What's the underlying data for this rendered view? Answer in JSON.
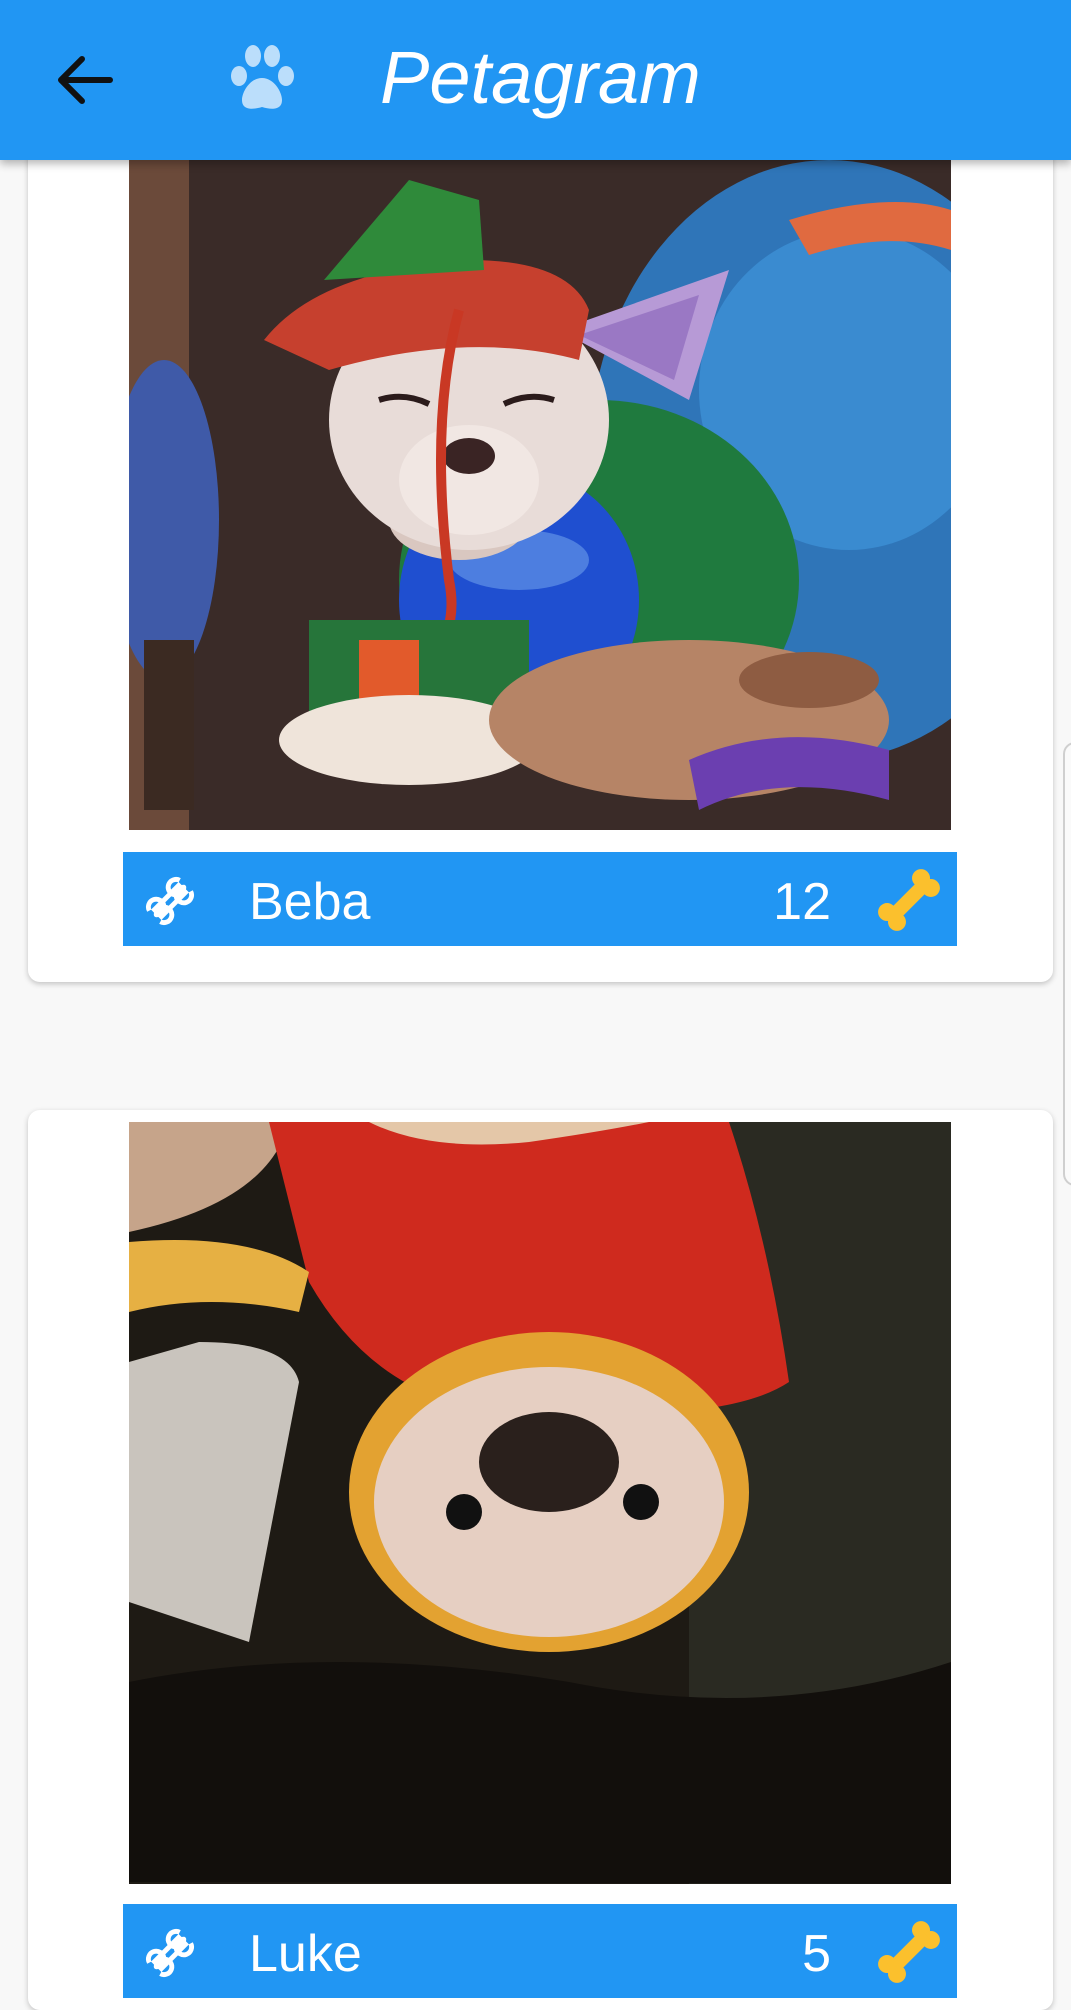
{
  "app_bar": {
    "title": "Petagram",
    "back_icon": "arrow-back-icon",
    "logo_icon": "paw-icon",
    "color": "#2196f3"
  },
  "pets": [
    {
      "name": "Beba",
      "likes": "12",
      "like_button_icon": "bone-outline-icon",
      "likes_icon": "bone-yellow-icon",
      "photo": "chihuahua-in-elf-hat-photo"
    },
    {
      "name": "Luke",
      "likes": "5",
      "like_button_icon": "bone-outline-icon",
      "likes_icon": "bone-yellow-icon",
      "photo": "chihuahua-in-red-hoodie-photo"
    }
  ],
  "colors": {
    "accent": "#2196f3",
    "bone_yellow": "#fbc02d"
  }
}
